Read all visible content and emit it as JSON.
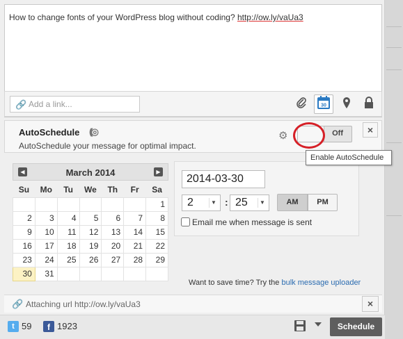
{
  "compose": {
    "message_text": "How to change fonts of your WordPress blog without coding? ",
    "message_link": "http://ow.ly/vaUa3",
    "link_placeholder": "Add a link...",
    "tools": [
      "paperclip-icon",
      "calendar-icon",
      "location-pin-icon",
      "lock-icon"
    ],
    "calendar_icon_day": "30"
  },
  "autoschedule": {
    "title": "AutoSchedule",
    "description": "AutoSchedule your message for optimal impact.",
    "toggle_label": "Off",
    "tooltip": "Enable AutoSchedule",
    "close": "×"
  },
  "calendar": {
    "month_label": "March 2014",
    "weekdays": [
      "Su",
      "Mo",
      "Tu",
      "We",
      "Th",
      "Fr",
      "Sa"
    ],
    "weeks": [
      [
        "",
        "",
        "",
        "",
        "",
        "",
        "1"
      ],
      [
        "2",
        "3",
        "4",
        "5",
        "6",
        "7",
        "8"
      ],
      [
        "9",
        "10",
        "11",
        "12",
        "13",
        "14",
        "15"
      ],
      [
        "16",
        "17",
        "18",
        "19",
        "20",
        "21",
        "22"
      ],
      [
        "23",
        "24",
        "25",
        "26",
        "27",
        "28",
        "29"
      ],
      [
        "30",
        "31",
        "",
        "",
        "",
        "",
        ""
      ]
    ],
    "selected_day": "30"
  },
  "time": {
    "date_value": "2014-03-30",
    "hour": "2",
    "minute": "25",
    "am_label": "AM",
    "pm_label": "PM",
    "selected_period": "AM",
    "email_label": "Email me when message is sent"
  },
  "bulk": {
    "prefix": "Want to save time? Try the ",
    "link": "bulk message uploader"
  },
  "attachment": {
    "text": "Attaching url http://ow.ly/vaUa3",
    "close": "×"
  },
  "footer": {
    "twitter_count": "59",
    "facebook_count": "1923",
    "schedule_label": "Schedule"
  }
}
